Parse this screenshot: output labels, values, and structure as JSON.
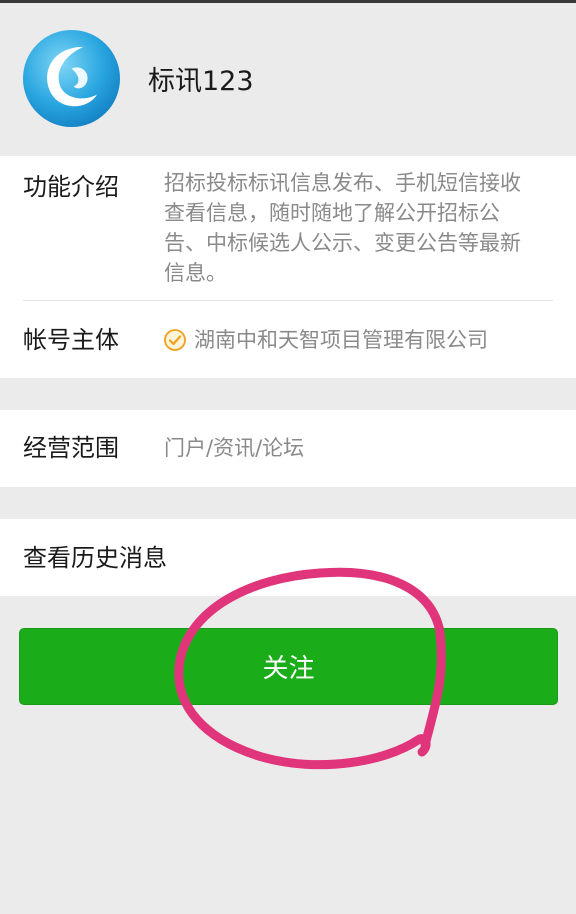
{
  "account": {
    "name": "标讯123",
    "avatar_icon": "blue-swirl-logo-icon"
  },
  "details": {
    "intro_label": "功能介绍",
    "intro_text": "招标投标标讯信息发布、手机短信接收查看信息，随时随地了解公开招标公告、中标候选人公示、变更公告等最新信息。",
    "subject_label": "帐号主体",
    "subject_icon": "verified-check-icon",
    "subject_value": "湖南中和天智项目管理有限公司"
  },
  "scope": {
    "label": "经营范围",
    "value": "门户/资讯/论坛"
  },
  "history": {
    "label": "查看历史消息"
  },
  "follow_button": {
    "label": "关注"
  },
  "colors": {
    "background": "#ebebeb",
    "primary_green": "#1aad19",
    "annotation_pink": "#e0357a",
    "verified_orange": "#f0a020"
  }
}
